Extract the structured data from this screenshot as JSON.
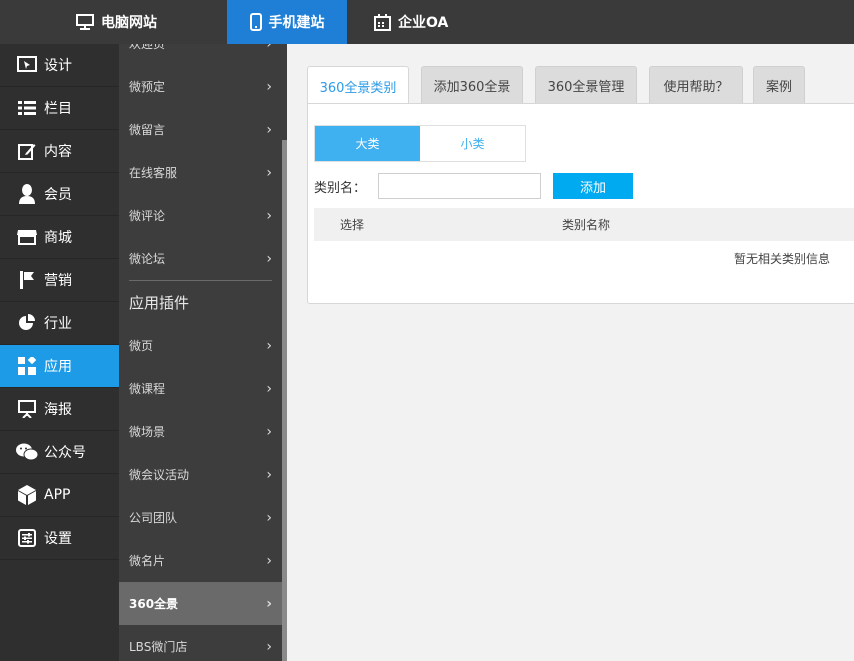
{
  "topbar": {
    "tabs": [
      {
        "label": "电脑网站",
        "icon": "monitor-icon"
      },
      {
        "label": "手机建站",
        "icon": "mobile-icon",
        "active": true
      },
      {
        "label": "企业OA",
        "icon": "calendar-icon"
      }
    ],
    "active_color": "#1f7fd6"
  },
  "sidebar": {
    "items": [
      {
        "label": "设计",
        "icon": "design-icon"
      },
      {
        "label": "栏目",
        "icon": "list-icon"
      },
      {
        "label": "内容",
        "icon": "edit-icon"
      },
      {
        "label": "会员",
        "icon": "user-icon"
      },
      {
        "label": "商城",
        "icon": "store-icon"
      },
      {
        "label": "营销",
        "icon": "flag-icon"
      },
      {
        "label": "行业",
        "icon": "pie-chart-icon"
      },
      {
        "label": "应用",
        "icon": "apps-icon",
        "active": true
      },
      {
        "label": "海报",
        "icon": "easel-icon"
      },
      {
        "label": "公众号",
        "icon": "wechat-icon"
      },
      {
        "label": "APP",
        "icon": "cube-icon"
      },
      {
        "label": "设置",
        "icon": "settings-icon"
      }
    ],
    "active_color": "#1e9be6"
  },
  "submenu": {
    "partial_top": "欢迎页",
    "items_top": [
      "微预定",
      "微留言",
      "在线客服",
      "微评论",
      "微论坛"
    ],
    "section_title": "应用插件",
    "items_bottom": [
      "微页",
      "微课程",
      "微场景",
      "微会议活动",
      "公司团队",
      "微名片",
      "360全景",
      "LBS微门店"
    ],
    "active_item": "360全景"
  },
  "content": {
    "tabs": [
      "360全景类别",
      "添加360全景",
      "360全景管理",
      "使用帮助？",
      "案例"
    ],
    "active_tab": "360全景类别",
    "segment": {
      "on": "大类",
      "off": "小类"
    },
    "form": {
      "label": "类别名：",
      "input_value": "",
      "add_button": "添加"
    },
    "table": {
      "headers": [
        "选择",
        "类别名称"
      ],
      "empty_message": "暂无相关类别信息"
    }
  }
}
